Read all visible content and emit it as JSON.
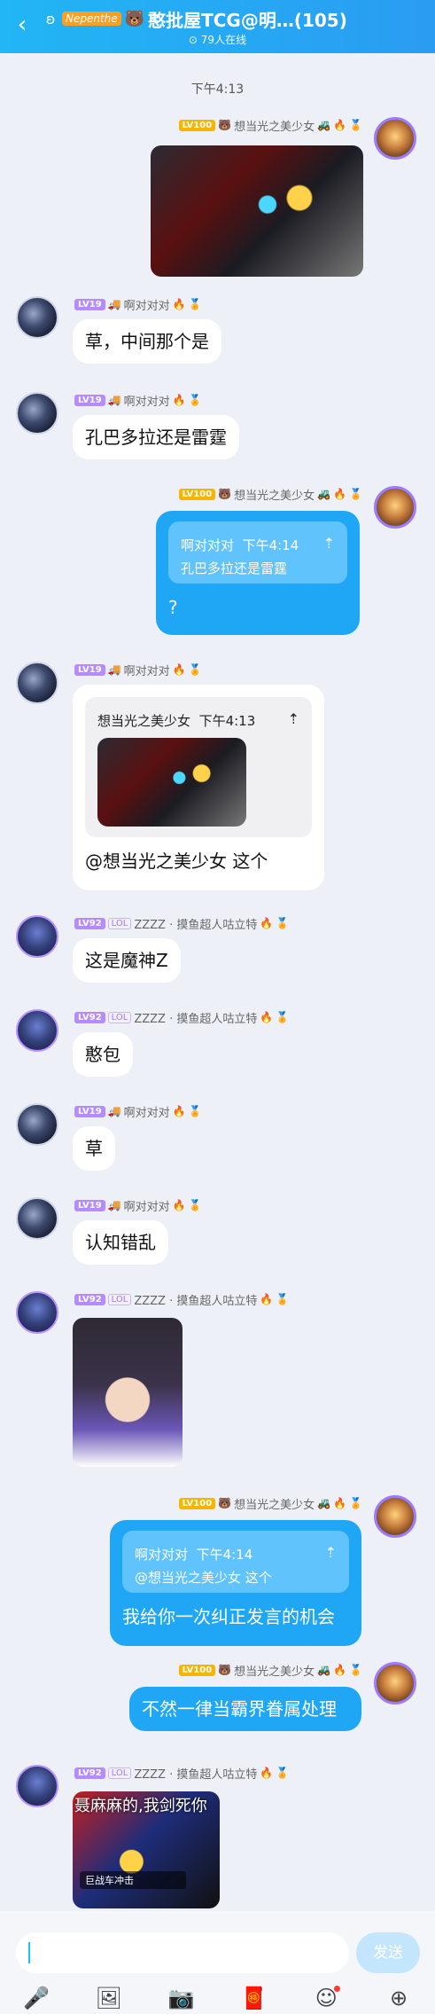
{
  "header": {
    "back_icon": "chevron-left-icon",
    "brand_badge": "Nepenthe",
    "title": "憨批屋TCG@明…(105)",
    "online": "79人在线"
  },
  "time_label": "下午4:13",
  "users": {
    "me": {
      "name": "想当光之美少女",
      "level": "LV100"
    },
    "duidui": {
      "name": "啊对对对",
      "level": "LV19"
    },
    "zzzz": {
      "name": "ZZZZ · 摸鱼超人咕立特",
      "level": "LV92",
      "tag": "LOL"
    }
  },
  "messages": {
    "m2": {
      "text": "草，中间那个是"
    },
    "m3": {
      "text": "孔巴多拉还是雷霆"
    },
    "m4": {
      "quote_author": "啊对对对",
      "quote_time": "下午4:14",
      "quote_text": "孔巴多拉还是雷霆",
      "text": "?"
    },
    "m5": {
      "quote_author": "想当光之美少女",
      "quote_time": "下午4:13",
      "text": "@想当光之美少女  这个"
    },
    "m6": {
      "text": "这是魔神Z"
    },
    "m7": {
      "text": "憨包"
    },
    "m8": {
      "text": "草"
    },
    "m9": {
      "text": "认知错乱"
    },
    "m11": {
      "quote_author": "啊对对对",
      "quote_time": "下午4:14",
      "quote_text": "@想当光之美少女  这个",
      "text": "我给你一次纠正发言的机会"
    },
    "m12": {
      "text": "不然一律当霸界眷属处理"
    },
    "m13": {
      "caption": "聂麻麻的,我剑死你",
      "card": "巨战车冲击"
    }
  },
  "input": {
    "placeholder": "",
    "send_label": "发送"
  },
  "toolbar": {
    "icons": [
      "microphone-icon",
      "image-icon",
      "camera-icon",
      "red-packet-icon",
      "emoji-icon",
      "plus-icon"
    ]
  }
}
